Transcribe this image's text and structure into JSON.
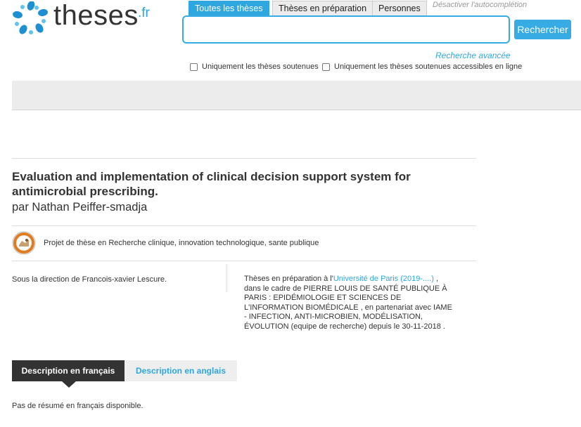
{
  "header": {
    "logo_word": "theses",
    "logo_tld": ".fr",
    "tabs": [
      {
        "label": "Toutes les thèses",
        "active": true
      },
      {
        "label": "Thèses en préparation",
        "active": false
      },
      {
        "label": "Personnes",
        "active": false
      }
    ],
    "autocomplete_label": "Désactiver l'autocomplétion",
    "search_value": "",
    "search_button": "Rechercher",
    "advanced_search": "Recherche avancée",
    "filters": [
      {
        "label": "Uniquement les thèses soutenues",
        "checked": false
      },
      {
        "label": "Uniquement les thèses soutenues accessibles en ligne",
        "checked": false
      }
    ]
  },
  "thesis": {
    "title": "Evaluation and implementation of clinical decision support system for antimicrobial prescribing.",
    "author": "par Nathan Peiffer-smadja",
    "project": "Projet de thèse en Recherche clinique, innovation technologique, sante publique",
    "direction": "Sous la direction de Francois-xavier Lescure.",
    "prep_prefix": "Thèses en préparation à l'",
    "university": "Université de Paris (2019-....)",
    "prep_suffix": " , dans le cadre de PIERRE LOUIS DE SANTÉ PUBLIQUE À PARIS : EPIDÉMIOLOGIE ET SCIENCES DE L'INFORMATION BIOMÉDICALE , en partenariat avec IAME - INFECTION, ANTI-MICROBIEN, MODÉLISATION, ÉVOLUTION (equipe de recherche) depuis le 30-11-2018 ."
  },
  "description": {
    "tab_fr": "Description en français",
    "tab_en": "Description en anglais",
    "no_abstract": "Pas de résumé en français disponible."
  },
  "colors": {
    "accent": "#2ea7e0",
    "dark": "#333333"
  }
}
